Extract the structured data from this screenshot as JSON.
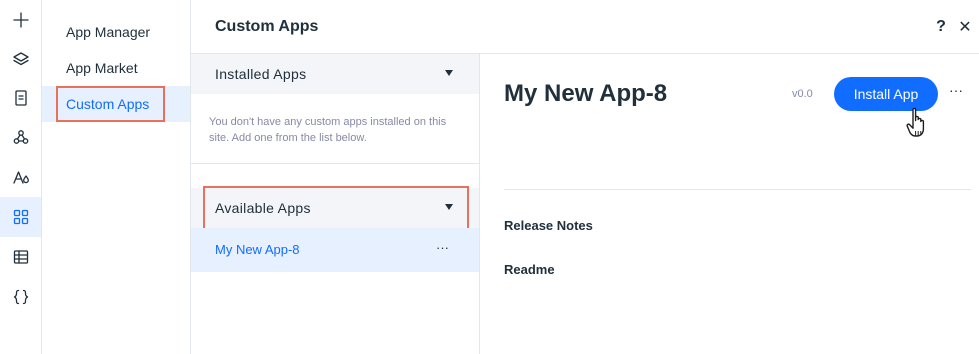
{
  "rail": {
    "items": [
      {
        "icon": "plus-icon"
      },
      {
        "icon": "layers-icon"
      },
      {
        "icon": "page-icon"
      },
      {
        "icon": "connections-icon"
      },
      {
        "icon": "theme-icon"
      },
      {
        "icon": "apps-grid-icon",
        "active": true
      },
      {
        "icon": "table-icon"
      },
      {
        "icon": "code-braces-icon"
      }
    ]
  },
  "nav": {
    "items": [
      {
        "label": "App Manager"
      },
      {
        "label": "App Market"
      },
      {
        "label": "Custom Apps",
        "active": true
      }
    ]
  },
  "header": {
    "title": "Custom Apps",
    "help_label": "?",
    "close_label": "✕"
  },
  "installed": {
    "heading": "Installed Apps",
    "empty_message": "You don't have any custom apps installed on this site. Add one from the list below."
  },
  "available": {
    "heading": "Available Apps",
    "apps": [
      {
        "name": "My New App-8",
        "more": "···"
      }
    ]
  },
  "detail": {
    "title": "My New App-8",
    "version": "v0.0",
    "install_label": "Install App",
    "more_label": "···",
    "links": [
      "Release Notes",
      "Readme"
    ]
  },
  "colors": {
    "accent": "#116dff",
    "highlight_outline": "#e8715d",
    "selected_bg": "#e7f0ff"
  }
}
